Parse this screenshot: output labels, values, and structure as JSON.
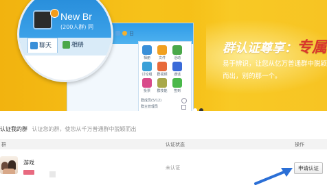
{
  "banner": {
    "qq_window": {
      "group_name": "New Br",
      "group_sub": "(200人群) 同",
      "tab_chat": "聊天",
      "tab_album": "相册",
      "toolbar_text": "日",
      "panel_footer": "群成员(5/12)",
      "panel_footer2": "群主管理员"
    },
    "apps": [
      {
        "label": "相册",
        "color": "#3a8fd8"
      },
      {
        "label": "文件",
        "color": "#f0a020"
      },
      {
        "label": "活动",
        "color": "#4aa84a"
      },
      {
        "label": "讨论组",
        "color": "#3aa0d8"
      },
      {
        "label": "群视频",
        "color": "#e86a3a"
      },
      {
        "label": "通话",
        "color": "#3a6ad8"
      },
      {
        "label": "投票",
        "color": "#d84a8a"
      },
      {
        "label": "群技能",
        "color": "#a8a84a"
      },
      {
        "label": "签到",
        "color": "#4ab84a"
      }
    ],
    "promo_title_main": "群认证尊享：",
    "promo_title_highlight": "专属",
    "promo_desc": "易于辨识，让您从亿万普通群中脱颖而出，别的那一个。",
    "accent_color": "#f6c21a",
    "highlight_color": "#d9372c"
  },
  "carousel": {
    "total": 2,
    "active_index": 1
  },
  "section": {
    "title": "认证我的群",
    "subtitle": "认证您的群，使您从千万普通群中脱颖而出"
  },
  "table": {
    "headers": {
      "group": "群",
      "status": "认证状态",
      "action": "操作"
    },
    "rows": [
      {
        "name": "游戏",
        "tag": "",
        "status": "未认证",
        "action_label": "申请认证"
      }
    ]
  }
}
